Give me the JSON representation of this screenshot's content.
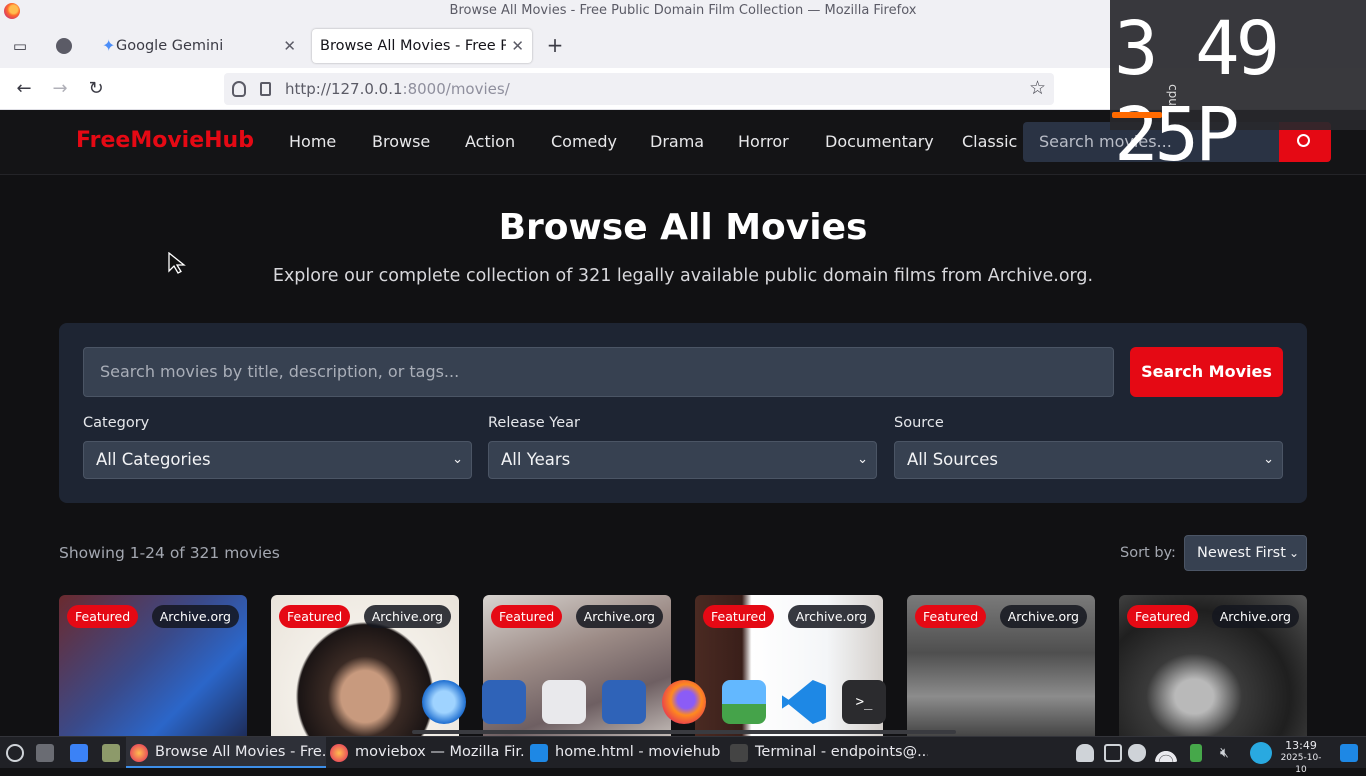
{
  "window": {
    "title": "Browse All Movies - Free Public Domain Film Collection — Mozilla Firefox"
  },
  "tabs": [
    {
      "label": "Google Gemini"
    },
    {
      "label": "Browse All Movies - Free Public Domain Film Collection",
      "active": true
    }
  ],
  "address": {
    "host": "http://127.0.0.1",
    "rest": ":8000/movies/"
  },
  "site": {
    "logo": "FreeMovieHub",
    "nav": [
      "Home",
      "Browse",
      "Action",
      "Comedy",
      "Drama",
      "Horror",
      "Documentary",
      "Classic"
    ],
    "search_placeholder": "Search movies..."
  },
  "hero": {
    "title": "Browse All Movies",
    "subtitle": "Explore our complete collection of 321 legally available public domain films from Archive.org."
  },
  "filters": {
    "search_placeholder": "Search movies by title, description, or tags...",
    "search_button": "Search Movies",
    "category": {
      "label": "Category",
      "value": "All Categories"
    },
    "year": {
      "label": "Release Year",
      "value": "All Years"
    },
    "source": {
      "label": "Source",
      "value": "All Sources"
    }
  },
  "results": {
    "showing": "Showing 1-24 of 321 movies",
    "sort_label": "Sort by:",
    "sort_value": "Newest First"
  },
  "cards": [
    {
      "featured": "Featured",
      "source": "Archive.org"
    },
    {
      "featured": "Featured",
      "source": "Archive.org"
    },
    {
      "featured": "Featured",
      "source": "Archive.org"
    },
    {
      "featured": "Featured",
      "source": "Archive.org"
    },
    {
      "featured": "Featured",
      "source": "Archive.org"
    },
    {
      "featured": "Featured",
      "source": "Archive.org"
    }
  ],
  "clock": {
    "digits": "3 49 25P",
    "cpu_label": "cpu"
  },
  "taskbar": {
    "items": [
      {
        "label": "Browse All Movies - Fre...",
        "active": true
      },
      {
        "label": "moviebox — Mozilla Fir..."
      },
      {
        "label": "home.html - moviehub ..."
      },
      {
        "label": "Terminal - endpoints@..."
      }
    ],
    "time": "13:49",
    "date": "2025-10-10"
  },
  "colors": {
    "brand": "#e50914",
    "panel": "#1e2533",
    "input": "#374151",
    "page_bg": "#111113"
  }
}
